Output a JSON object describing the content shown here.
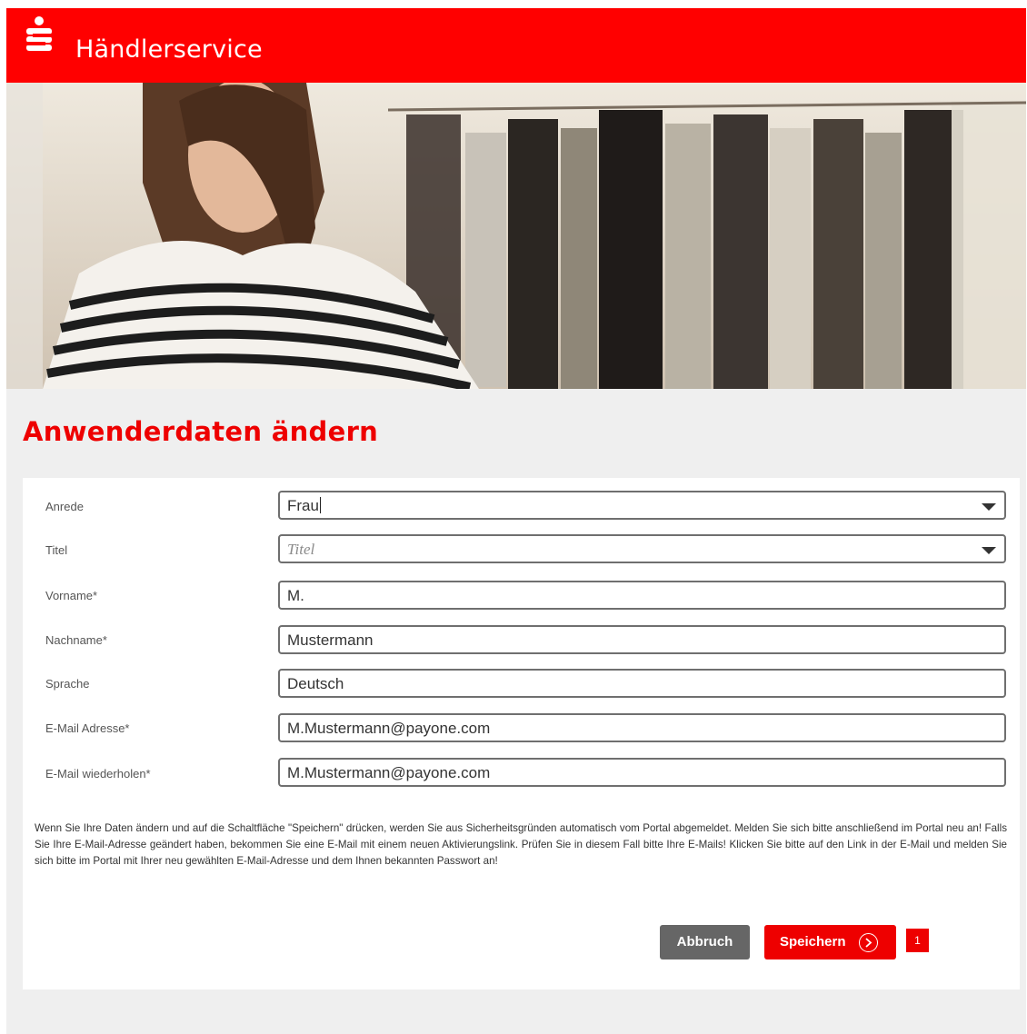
{
  "header": {
    "brand": "Händlerservice",
    "logo_icon": "sparkasse-s-logo-icon"
  },
  "hero": {
    "image": "shopping-woman-hero-image"
  },
  "page_title": "Anwenderdaten ändern",
  "form": {
    "anrede": {
      "label": "Anrede",
      "value": "Frau"
    },
    "titel": {
      "label": "Titel",
      "placeholder": "Titel"
    },
    "vorname": {
      "label": "Vorname*",
      "value": "M."
    },
    "nachname": {
      "label": "Nachname*",
      "value": "Mustermann"
    },
    "sprache": {
      "label": "Sprache",
      "value": "Deutsch"
    },
    "email": {
      "label": "E-Mail Adresse*",
      "value": "M.Mustermann@payone.com"
    },
    "email_repeat": {
      "label": "E-Mail wiederholen*",
      "value": "M.Mustermann@payone.com"
    }
  },
  "notice": "Wenn Sie Ihre Daten ändern und auf die Schaltfläche \"Speichern\" drücken, werden Sie aus Sicherheitsgründen automatisch vom Portal abgemeldet. Melden Sie sich bitte anschließend im Portal neu an! Falls Sie Ihre E-Mail-Adresse geändert haben, bekommen Sie eine E-Mail mit einem neuen Aktivierungslink. Prüfen Sie in diesem Fall bitte Ihre E-Mails! Klicken Sie bitte auf den Link in der E-Mail und melden Sie sich bitte im Portal mit Ihrer neu gewählten E-Mail-Adresse und dem Ihnen bekannten Passwort an!",
  "buttons": {
    "cancel": "Abbruch",
    "save": "Speichern"
  },
  "marker": "1",
  "colors": {
    "brand_red": "#ff0000",
    "button_gray": "#666666",
    "background": "#efefef"
  }
}
